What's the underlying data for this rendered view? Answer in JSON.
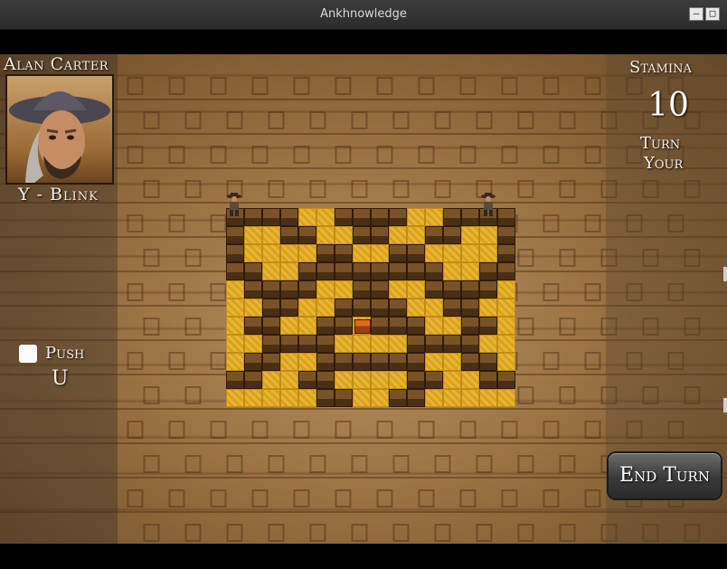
{
  "window": {
    "title": "Ankhnowledge",
    "minimize_icon": "minus",
    "restore_icon": "square"
  },
  "player": {
    "name": "Alan Carter",
    "ability": "Y - Blink",
    "portrait_icon": "explorer-portrait"
  },
  "actions": {
    "push_label": "Push",
    "push_key": "U"
  },
  "status": {
    "stamina_label": "Stamina",
    "stamina_value": "10",
    "turn_label": "Turn",
    "turn_owner": "Your"
  },
  "buttons": {
    "end_turn": "End Turn"
  },
  "board": {
    "legend": {
      "F": "sand-floor",
      "W": "stone-wall",
      "C": "treasure-chest"
    },
    "rows": [
      "WWWWFFWWWWFFWWWW",
      "WFFWWFFWWFFWWFFW",
      "WFFFFWWFFWWFFFFW",
      "WWFFWWWWWWWWFFWW",
      "FWWWWFFWWFFWWWWF",
      "FFWWFFWWWWFFWWFF",
      "FWWFFWWCWWWFFWWF",
      "FFWWWWFFFFWWWWFF",
      "FWWFFWWWWWWFFWWF",
      "WWFFWWFFFFWWFFWW",
      "FFFFFWWFFWWFFFFF"
    ]
  },
  "units": [
    {
      "name": "explorer-1",
      "icon": "fedora-explorer"
    },
    {
      "name": "explorer-2",
      "icon": "fedora-explorer"
    }
  ],
  "colors": {
    "floor": "#e8b530",
    "wall": "#5a3a1a",
    "panel_text": "#f4efe6"
  }
}
